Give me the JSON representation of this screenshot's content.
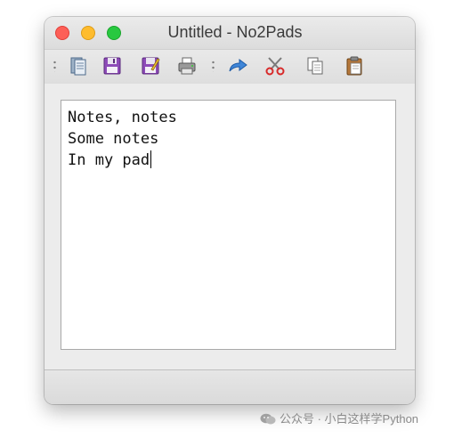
{
  "window": {
    "title": "Untitled - No2Pads"
  },
  "toolbar": {
    "buttons": [
      {
        "name": "new",
        "icon": "new-document-icon"
      },
      {
        "name": "save",
        "icon": "floppy-disk-icon"
      },
      {
        "name": "save-as",
        "icon": "floppy-edit-icon"
      },
      {
        "name": "print",
        "icon": "printer-icon"
      },
      {
        "name": "redo",
        "icon": "redo-arrow-icon"
      },
      {
        "name": "cut",
        "icon": "scissors-icon"
      },
      {
        "name": "copy",
        "icon": "copy-icon"
      },
      {
        "name": "paste",
        "icon": "clipboard-icon"
      }
    ]
  },
  "editor": {
    "lines": [
      "Notes, notes",
      "Some notes",
      "In my pad"
    ]
  },
  "watermark": {
    "text": "公众号 · 小白这样学Python"
  }
}
